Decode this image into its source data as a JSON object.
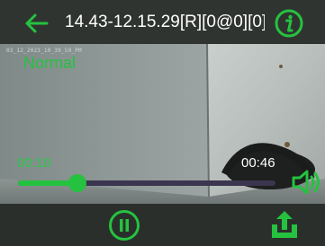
{
  "header": {
    "title": "14.43-12.15.29[R][0@0][0]_",
    "back_icon": "arrow-left-icon",
    "info_icon": "info-circle-icon"
  },
  "player": {
    "stamp": "03_12_2023_10_39_59_PM",
    "mode": "Normal",
    "current_time": "00:10",
    "total_time": "00:46",
    "progress_fraction": 0.23,
    "volume_icon": "speaker-volume-icon"
  },
  "controls": {
    "pause_icon": "pause-circle-icon",
    "share_icon": "share-upload-icon"
  },
  "colors": {
    "accent": "#25c240",
    "bar_bg": "#303430",
    "track": "#3b3550"
  }
}
